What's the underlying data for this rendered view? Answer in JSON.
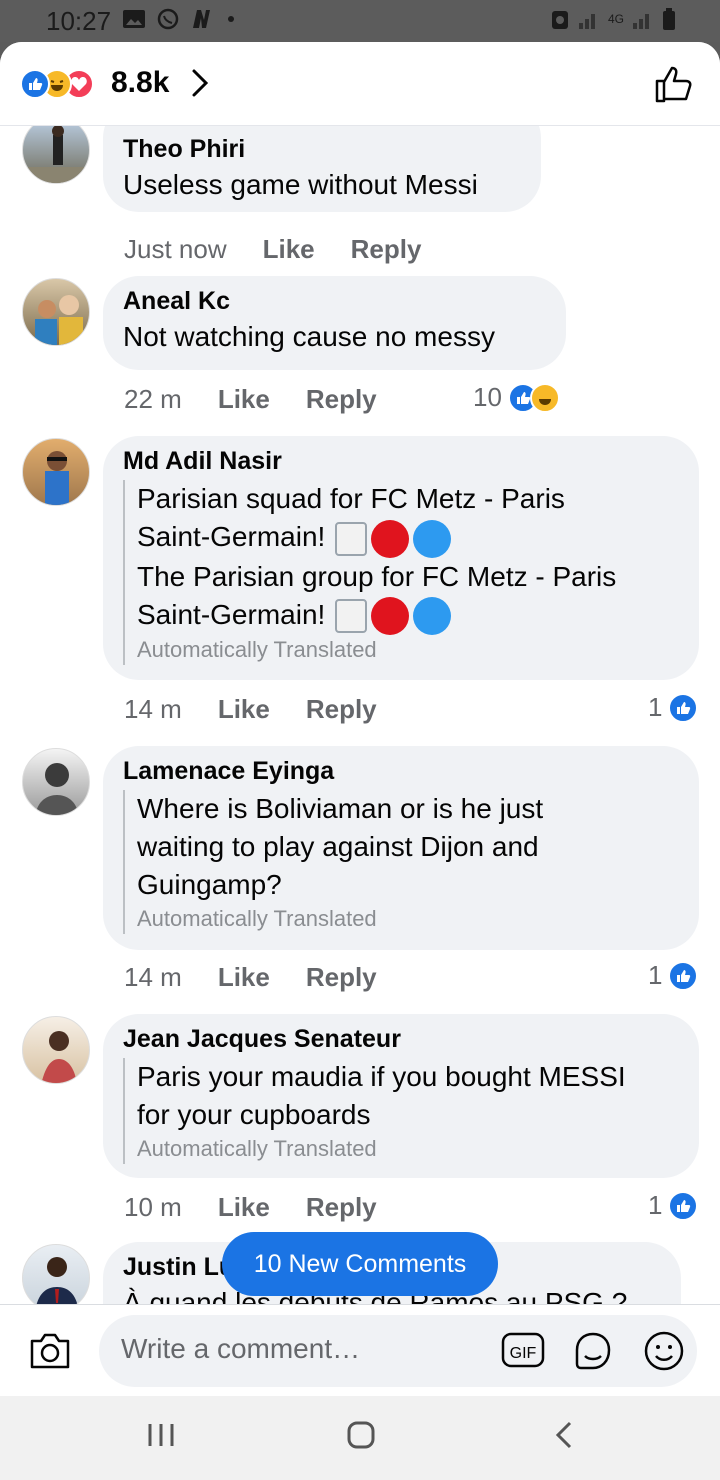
{
  "status_bar": {
    "time": "10:27",
    "network": "4G"
  },
  "header": {
    "reaction_count": "8.8k",
    "reactions": [
      "like-icon",
      "haha-icon",
      "love-icon"
    ]
  },
  "comments": [
    {
      "author": "Theo Phiri",
      "lines": [
        "Useless game without Messi"
      ],
      "time": "Just now",
      "like": "Like",
      "reply": "Reply"
    },
    {
      "author": "Aneal Kc",
      "lines": [
        "Not watching cause no messy"
      ],
      "time": "22 m",
      "like": "Like",
      "reply": "Reply",
      "reactions": "10"
    },
    {
      "author": "Md Adil Nasir",
      "lines": [
        "Parisian squad for FC Metz - Paris",
        "Saint-Germain!",
        "The Parisian group for FC Metz - Paris",
        "Saint-Germain!"
      ],
      "translated": "Automatically Translated",
      "time": "14 m",
      "like": "Like",
      "reply": "Reply",
      "reactions": "1"
    },
    {
      "author": "Lamenace Eyinga",
      "lines": [
        "Where is Boliviaman or is he just",
        "waiting to play against Dijon and",
        "Guingamp?"
      ],
      "translated": "Automatically Translated",
      "time": "14 m",
      "like": "Like",
      "reply": "Reply",
      "reactions": "1"
    },
    {
      "author": "Jean Jacques Senateur",
      "lines": [
        "Paris your maudia if you bought MESSI",
        "for your cupboards"
      ],
      "translated": "Automatically Translated",
      "time": "10 m",
      "like": "Like",
      "reply": "Reply",
      "reactions": "1"
    },
    {
      "author": "Justin Lu",
      "lines": [
        "À quand les débuts de Ramos au PSG ?"
      ]
    }
  ],
  "new_comments_pill": "10 New Comments",
  "composer": {
    "placeholder": "Write a comment…",
    "gif_label": "GIF"
  },
  "colors": {
    "accent": "#1b74e4",
    "bubble": "#f0f2f5",
    "meta": "#65676b"
  }
}
